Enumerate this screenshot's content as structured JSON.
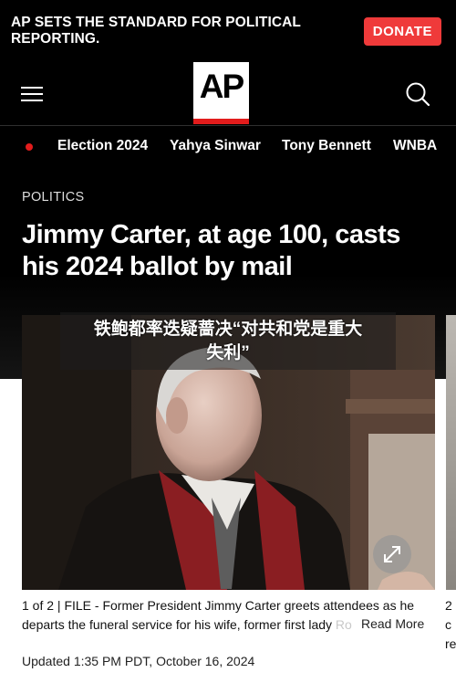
{
  "banner": {
    "text": "AP SETS THE STANDARD FOR POLITICAL REPORTING.",
    "donate_label": "DONATE"
  },
  "header": {
    "logo_text": "AP",
    "menu_icon": "hamburger-menu-icon",
    "search_icon": "search-icon"
  },
  "nav": {
    "items": [
      "Election 2024",
      "Yahya Sinwar",
      "Tony Bennett",
      "WNBA"
    ]
  },
  "article": {
    "section": "POLITICS",
    "headline": "Jimmy Carter, at age 100, casts his 2024 ballot by mail",
    "overlay_line1": "铁鲍都率迭疑蔷决“对共和党是重大",
    "overlay_line2": "失利”",
    "caption_main": "1 of 2 | FILE - Former President Jimmy Carter greets attendees as he departs the funeral service for his wife, former first lady ",
    "caption_fade": "Ros",
    "read_more": "Read More",
    "next_caption_line1": "2 c",
    "next_caption_line2": "re",
    "updated": "Updated 1:35 PM PDT, October 16, 2024"
  },
  "colors": {
    "accent_red": "#e21c1c",
    "donate_red": "#ef3a3a",
    "dark_bg": "#000000"
  }
}
